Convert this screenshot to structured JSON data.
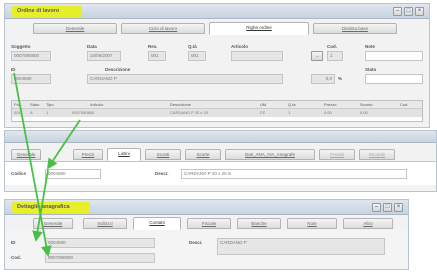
{
  "window1": {
    "title": "Ordine di lavoro",
    "tabs": [
      "Generale",
      "Ciclo di lavoro",
      "Righe ordine",
      "Distinta base"
    ],
    "active_tab": 2,
    "fields": {
      "subject_label": "Soggetto",
      "subject_value": "0007080800",
      "date_label": "Data",
      "date_value": "10/06/2007",
      "rev_label": "Rev.",
      "rev_value": "001",
      "qty_label": "Q.tà",
      "qty_value": "001",
      "article_label": "Articolo",
      "code_label": "Cod.",
      "code_value": "1",
      "note_label": "Note",
      "id_label": "ID",
      "id_value": "0004590",
      "desc_label": "Descrizione",
      "desc_value": "CARDANO P",
      "pct_value": "0,0",
      "pct_unit": "%",
      "status_label": "Stato"
    },
    "grid": {
      "columns": [
        "Pos.",
        "Stato",
        "Tipo",
        "Articolo",
        "Descrizione",
        "UM",
        "Q.tà",
        "Prezzo",
        "Sconto",
        "Cod."
      ],
      "row": [
        "001",
        "A",
        "1",
        "0007080800",
        "CARDANO P 20 x 20",
        "PZ",
        "1",
        "0,00",
        "0,00",
        ""
      ]
    }
  },
  "window2": {
    "tabs": [
      "Generale",
      "Prezzi",
      "Listini",
      "Sconti",
      "Scorte",
      "Dati_ANA_IVA_Anagrafe",
      "Prestiti",
      "Ricambi"
    ],
    "active_tab": 2,
    "code_label": "Codice",
    "code_value": "0004590",
    "desc_label": "Descr.",
    "desc_value": "CARDANO P 20 x 20 in"
  },
  "window3": {
    "title": "Dettaglio anagrafica",
    "tabs": [
      "Generale",
      "Indirizzi",
      "Contatti",
      "Fiscale",
      "Banche",
      "Note",
      "Altro"
    ],
    "active_tab": 2,
    "id_label": "ID",
    "id_value": "0004590",
    "cod_label": "Cod.",
    "cod_value": "0007080800",
    "desc_label": "Descr.",
    "desc_value": "CARDANO P"
  },
  "colors": {
    "highlight": "#e7ef2c",
    "arrow": "#48c048"
  }
}
